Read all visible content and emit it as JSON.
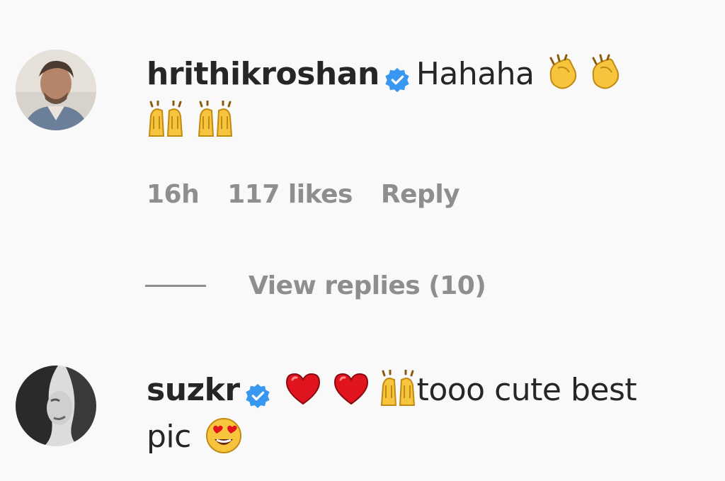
{
  "comments": [
    {
      "username": "hrithikroshan",
      "verified": true,
      "text_before": "Hahaha",
      "emojis": [
        "clapping-hands",
        "clapping-hands",
        "raising-hands",
        "raising-hands"
      ],
      "timestamp": "16h",
      "likes": "117 likes",
      "reply_label": "Reply",
      "view_replies_label": "View replies (10)"
    },
    {
      "username": "suzkr",
      "verified": true,
      "text": "tooo cute best",
      "text_line2": "pic",
      "emojis": [
        "red-heart",
        "red-heart",
        "raising-hands",
        "heart-eyes-face"
      ]
    }
  ],
  "colors": {
    "text": "#262626",
    "secondary": "#8e8e8e",
    "verified_blue": "#3897f0",
    "background": "#f9f9f9"
  }
}
